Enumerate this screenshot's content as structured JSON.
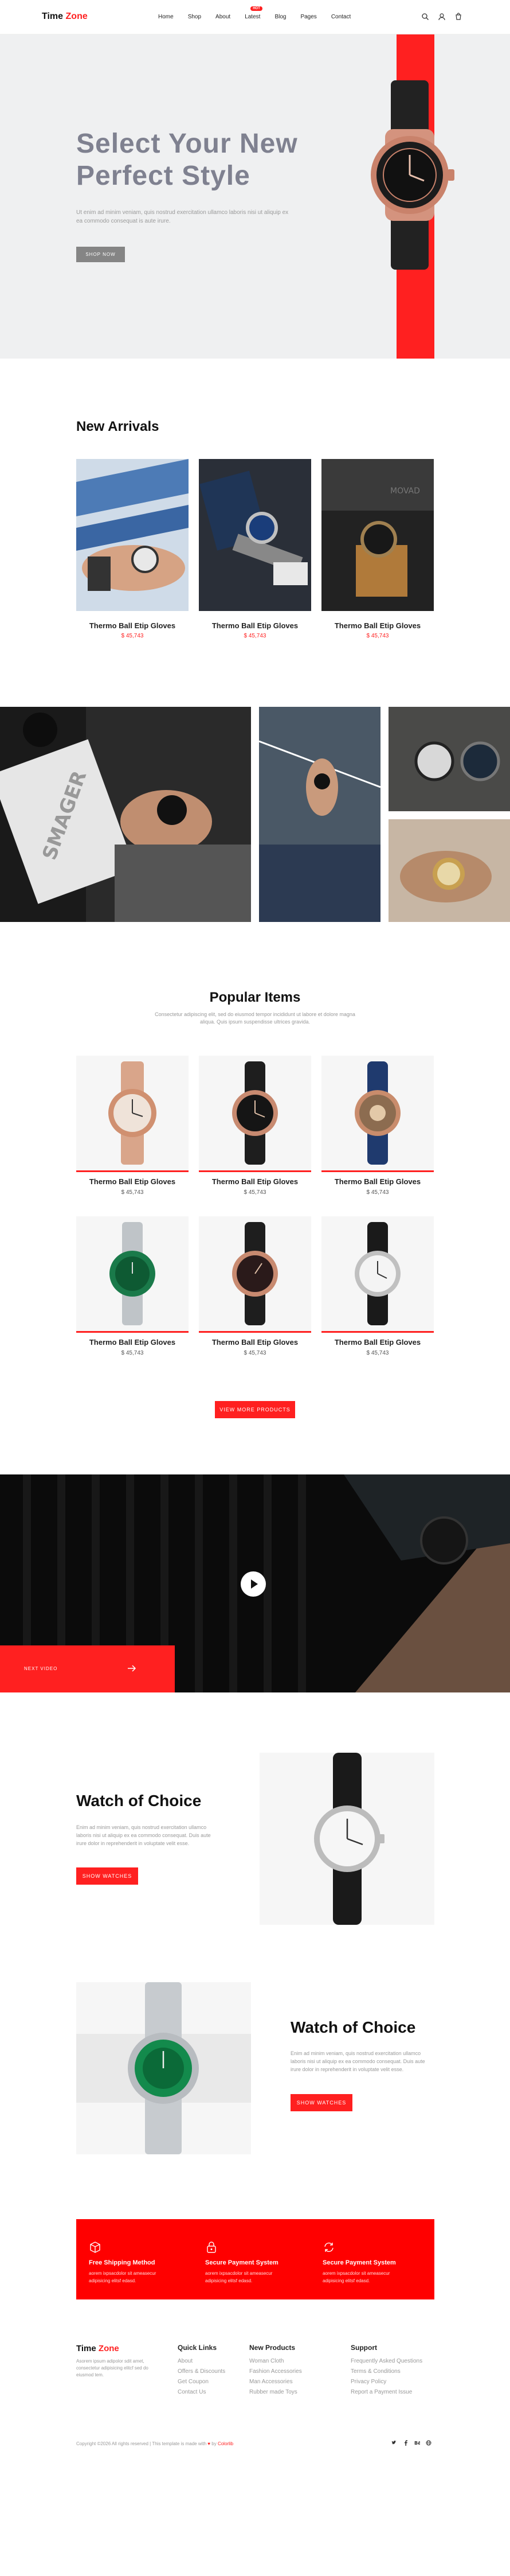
{
  "header": {
    "logo_main": "Time",
    "logo_accent": "Zone",
    "nav": [
      "Home",
      "Shop",
      "About",
      "Latest",
      "Blog",
      "Pages",
      "Contact"
    ],
    "badge": "HOT"
  },
  "hero": {
    "title_line1": "Select Your New",
    "title_line2": "Perfect Style",
    "text": "Ut enim ad minim veniam, quis nostrud exercitation ullamco laboris nisi ut aliquip ex ea commodo consequat is aute irure.",
    "button": "SHOP NOW"
  },
  "new_arrivals": {
    "title": "New Arrivals",
    "items": [
      {
        "name": "Thermo Ball Etip Gloves",
        "price": "$ 45,743"
      },
      {
        "name": "Thermo Ball Etip Gloves",
        "price": "$ 45,743"
      },
      {
        "name": "Thermo Ball Etip Gloves",
        "price": "$ 45,743"
      }
    ]
  },
  "popular": {
    "title": "Popular Items",
    "subtitle_line1": "Consectetur adipiscing elit, sed do eiusmod tempor incididunt ut labore et dolore magna",
    "subtitle_line2": "aliqua. Quis ipsum suspendisse ultrices gravida.",
    "items": [
      {
        "name": "Thermo Ball Etip Gloves",
        "price": "$ 45,743"
      },
      {
        "name": "Thermo Ball Etip Gloves",
        "price": "$ 45,743"
      },
      {
        "name": "Thermo Ball Etip Gloves",
        "price": "$ 45,743"
      },
      {
        "name": "Thermo Ball Etip Gloves",
        "price": "$ 45,743"
      },
      {
        "name": "Thermo Ball Etip Gloves",
        "price": "$ 45,743"
      },
      {
        "name": "Thermo Ball Etip Gloves",
        "price": "$ 45,743"
      }
    ],
    "button": "VIEW MORE PRODUCTS"
  },
  "video": {
    "next_label": "NEXT VIDEO"
  },
  "choice1": {
    "title": "Watch of Choice",
    "text": "Enim ad minim veniam, quis nostrud exercitation ullamco laboris nisi ut aliquip ex ea commodo consequat. Duis aute irure dolor in reprehenderit in voluptate velit esse.",
    "button": "SHOW WATCHES"
  },
  "choice2": {
    "title": "Watch of Choice",
    "text": "Enim ad minim veniam, quis nostrud exercitation ullamco laboris nisi ut aliquip ex ea commodo consequat. Duis aute irure dolor in reprehenderit in voluptate velit esse.",
    "button": "SHOW WATCHES"
  },
  "features": [
    {
      "title": "Free Shipping Method",
      "line1": "aorem ixpsacdolor sit ameasecur",
      "line2": "adipisicing elitsf edasd."
    },
    {
      "title": "Secure Payment System",
      "line1": "aorem ixpsacdolor sit ameasecur",
      "line2": "adipisicing elitsf edasd."
    },
    {
      "title": "Secure Payment System",
      "line1": "aorem ixpsacdolor sit ameasecur",
      "line2": "adipisicing elitsf edasd."
    }
  ],
  "footer": {
    "about_lines": [
      "Asorem ipsum adipolor sdit amet,",
      "consectetur adipisicing elitcf sed do",
      "eiusmod tem."
    ],
    "quick_title": "Quick Links",
    "quick": [
      "About",
      "Offers & Discounts",
      "Get Coupon",
      "Contact Us"
    ],
    "new_title": "New Products",
    "new": [
      "Woman Cloth",
      "Fashion Accessories",
      "Man Accessories",
      "Rubber made Toys"
    ],
    "support_title": "Support",
    "support": [
      "Frequently Asked Questions",
      "Terms & Conditions",
      "Privacy Policy",
      "Report a Payment Issue"
    ],
    "copyright_main": "Copyright ©2026 All rights reserved | This template is made with",
    "copyright_by": "by",
    "copyright_brand": "Colorlib",
    "social": [
      "twitter",
      "facebook",
      "behance",
      "globe"
    ]
  },
  "colors": {
    "accent": "#ff2020",
    "hero_bg": "#eff0f1",
    "title_grey": "#7f8190"
  }
}
